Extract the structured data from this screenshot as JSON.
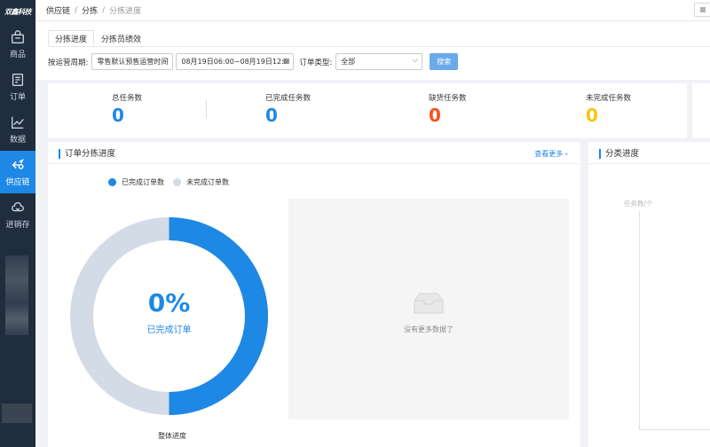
{
  "sidebar": {
    "logo": "双鑫科技",
    "items": [
      {
        "label": "商品",
        "icon": "bag-icon"
      },
      {
        "label": "订单",
        "icon": "document-icon"
      },
      {
        "label": "数据",
        "icon": "line-chart-icon"
      },
      {
        "label": "供应链",
        "icon": "exchange-icon",
        "active": true
      },
      {
        "label": "进销存",
        "icon": "cloud-box-icon"
      }
    ]
  },
  "breadcrumb": {
    "items": [
      "供应链",
      "分拣",
      "分拣进度"
    ]
  },
  "tabs": [
    "分拣进度",
    "分拣员绩效"
  ],
  "filters": {
    "period_label": "按运营周期:",
    "period_value": "零售默认预售运营时间",
    "date_range": "08月19日06:00~08月19日12:00",
    "type_label": "订单类型:",
    "type_value": "全部",
    "search_label": "搜索"
  },
  "stats": [
    {
      "label": "总任务数",
      "value": "0",
      "color": "#1e88e5"
    },
    {
      "label": "已完成任务数",
      "value": "0",
      "color": "#1e88e5"
    },
    {
      "label": "缺货任务数",
      "value": "0",
      "color": "#f4511e"
    },
    {
      "label": "未完成任务数",
      "value": "0",
      "color": "#f5c518"
    }
  ],
  "order_card": {
    "title": "订单分拣进度",
    "more": "查看更多 ›",
    "legend": [
      {
        "label": "已完成订单数",
        "color": "#1e88e5"
      },
      {
        "label": "未完成订单数",
        "color": "#d3dbe6"
      }
    ],
    "donut_percent": "0%",
    "donut_label": "已完成订单",
    "donut_caption": "整体进度",
    "empty_text": "没有更多数据了"
  },
  "category_card": {
    "title": "分类进度",
    "y_label": "任务数/个"
  }
}
